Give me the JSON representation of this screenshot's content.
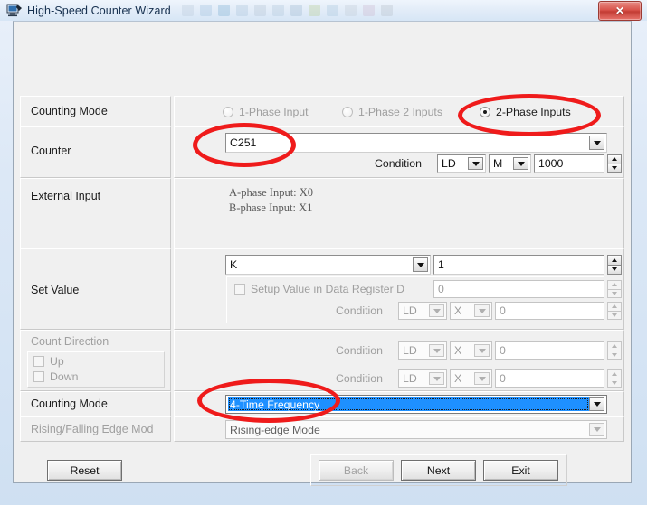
{
  "window": {
    "title": "High-Speed Counter Wizard",
    "icon": "wizard-monitor-icon",
    "close_label": "✕"
  },
  "rows": {
    "counting_mode_top": {
      "label": "Counting Mode",
      "options": [
        {
          "label": "1-Phase Input",
          "selected": false
        },
        {
          "label": "1-Phase 2 Inputs",
          "selected": false
        },
        {
          "label": "2-Phase Inputs",
          "selected": true
        }
      ]
    },
    "counter": {
      "label": "Counter",
      "value": "C251",
      "condition_label": "Condition",
      "cond_op": "LD",
      "cond_dev": "M",
      "cond_num": "1000"
    },
    "external_input": {
      "label": "External Input",
      "a_phase": "A-phase Input: X0",
      "b_phase": "B-phase Input: X1"
    },
    "set_value": {
      "label": "Set Value",
      "type": "K",
      "value": "1",
      "checkbox_label": "Setup Value in Data Register D",
      "checkbox_checked": false,
      "register_value": "0",
      "condition_label": "Condition",
      "cond_op": "LD",
      "cond_dev": "X",
      "cond_num": "0"
    },
    "count_direction": {
      "label": "Count Direction",
      "up_label": "Up",
      "down_label": "Down",
      "up_checked": false,
      "down_checked": false,
      "cond1_label": "Condition",
      "cond1_op": "LD",
      "cond1_dev": "X",
      "cond1_num": "0",
      "cond2_label": "Condition",
      "cond2_op": "LD",
      "cond2_dev": "X",
      "cond2_num": "0"
    },
    "counting_mode_bottom": {
      "label": "Counting Mode",
      "value": "4-Time Frequency"
    },
    "edge_mode": {
      "label": "Rising/Falling Edge Mod",
      "value": "Rising-edge Mode"
    }
  },
  "buttons": {
    "reset": "Reset",
    "back": "Back",
    "next": "Next",
    "exit": "Exit"
  },
  "colors": {
    "annotation": "#ef1b1b",
    "selection": "#1e90ff",
    "close": "#c33c34"
  }
}
